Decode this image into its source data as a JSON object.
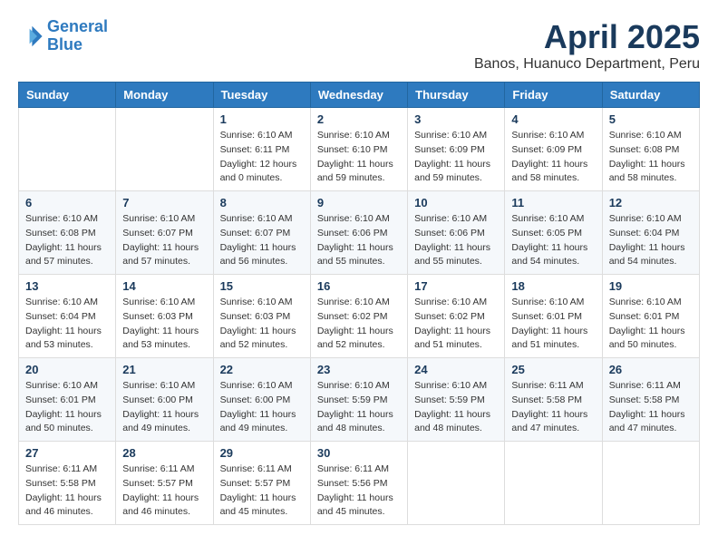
{
  "logo": {
    "line1": "General",
    "line2": "Blue"
  },
  "title": "April 2025",
  "location": "Banos, Huanuco Department, Peru",
  "days_of_week": [
    "Sunday",
    "Monday",
    "Tuesday",
    "Wednesday",
    "Thursday",
    "Friday",
    "Saturday"
  ],
  "weeks": [
    [
      {
        "day": "",
        "info": ""
      },
      {
        "day": "",
        "info": ""
      },
      {
        "day": "1",
        "info": "Sunrise: 6:10 AM\nSunset: 6:11 PM\nDaylight: 12 hours\nand 0 minutes."
      },
      {
        "day": "2",
        "info": "Sunrise: 6:10 AM\nSunset: 6:10 PM\nDaylight: 11 hours\nand 59 minutes."
      },
      {
        "day": "3",
        "info": "Sunrise: 6:10 AM\nSunset: 6:09 PM\nDaylight: 11 hours\nand 59 minutes."
      },
      {
        "day": "4",
        "info": "Sunrise: 6:10 AM\nSunset: 6:09 PM\nDaylight: 11 hours\nand 58 minutes."
      },
      {
        "day": "5",
        "info": "Sunrise: 6:10 AM\nSunset: 6:08 PM\nDaylight: 11 hours\nand 58 minutes."
      }
    ],
    [
      {
        "day": "6",
        "info": "Sunrise: 6:10 AM\nSunset: 6:08 PM\nDaylight: 11 hours\nand 57 minutes."
      },
      {
        "day": "7",
        "info": "Sunrise: 6:10 AM\nSunset: 6:07 PM\nDaylight: 11 hours\nand 57 minutes."
      },
      {
        "day": "8",
        "info": "Sunrise: 6:10 AM\nSunset: 6:07 PM\nDaylight: 11 hours\nand 56 minutes."
      },
      {
        "day": "9",
        "info": "Sunrise: 6:10 AM\nSunset: 6:06 PM\nDaylight: 11 hours\nand 55 minutes."
      },
      {
        "day": "10",
        "info": "Sunrise: 6:10 AM\nSunset: 6:06 PM\nDaylight: 11 hours\nand 55 minutes."
      },
      {
        "day": "11",
        "info": "Sunrise: 6:10 AM\nSunset: 6:05 PM\nDaylight: 11 hours\nand 54 minutes."
      },
      {
        "day": "12",
        "info": "Sunrise: 6:10 AM\nSunset: 6:04 PM\nDaylight: 11 hours\nand 54 minutes."
      }
    ],
    [
      {
        "day": "13",
        "info": "Sunrise: 6:10 AM\nSunset: 6:04 PM\nDaylight: 11 hours\nand 53 minutes."
      },
      {
        "day": "14",
        "info": "Sunrise: 6:10 AM\nSunset: 6:03 PM\nDaylight: 11 hours\nand 53 minutes."
      },
      {
        "day": "15",
        "info": "Sunrise: 6:10 AM\nSunset: 6:03 PM\nDaylight: 11 hours\nand 52 minutes."
      },
      {
        "day": "16",
        "info": "Sunrise: 6:10 AM\nSunset: 6:02 PM\nDaylight: 11 hours\nand 52 minutes."
      },
      {
        "day": "17",
        "info": "Sunrise: 6:10 AM\nSunset: 6:02 PM\nDaylight: 11 hours\nand 51 minutes."
      },
      {
        "day": "18",
        "info": "Sunrise: 6:10 AM\nSunset: 6:01 PM\nDaylight: 11 hours\nand 51 minutes."
      },
      {
        "day": "19",
        "info": "Sunrise: 6:10 AM\nSunset: 6:01 PM\nDaylight: 11 hours\nand 50 minutes."
      }
    ],
    [
      {
        "day": "20",
        "info": "Sunrise: 6:10 AM\nSunset: 6:01 PM\nDaylight: 11 hours\nand 50 minutes."
      },
      {
        "day": "21",
        "info": "Sunrise: 6:10 AM\nSunset: 6:00 PM\nDaylight: 11 hours\nand 49 minutes."
      },
      {
        "day": "22",
        "info": "Sunrise: 6:10 AM\nSunset: 6:00 PM\nDaylight: 11 hours\nand 49 minutes."
      },
      {
        "day": "23",
        "info": "Sunrise: 6:10 AM\nSunset: 5:59 PM\nDaylight: 11 hours\nand 48 minutes."
      },
      {
        "day": "24",
        "info": "Sunrise: 6:10 AM\nSunset: 5:59 PM\nDaylight: 11 hours\nand 48 minutes."
      },
      {
        "day": "25",
        "info": "Sunrise: 6:11 AM\nSunset: 5:58 PM\nDaylight: 11 hours\nand 47 minutes."
      },
      {
        "day": "26",
        "info": "Sunrise: 6:11 AM\nSunset: 5:58 PM\nDaylight: 11 hours\nand 47 minutes."
      }
    ],
    [
      {
        "day": "27",
        "info": "Sunrise: 6:11 AM\nSunset: 5:58 PM\nDaylight: 11 hours\nand 46 minutes."
      },
      {
        "day": "28",
        "info": "Sunrise: 6:11 AM\nSunset: 5:57 PM\nDaylight: 11 hours\nand 46 minutes."
      },
      {
        "day": "29",
        "info": "Sunrise: 6:11 AM\nSunset: 5:57 PM\nDaylight: 11 hours\nand 45 minutes."
      },
      {
        "day": "30",
        "info": "Sunrise: 6:11 AM\nSunset: 5:56 PM\nDaylight: 11 hours\nand 45 minutes."
      },
      {
        "day": "",
        "info": ""
      },
      {
        "day": "",
        "info": ""
      },
      {
        "day": "",
        "info": ""
      }
    ]
  ]
}
